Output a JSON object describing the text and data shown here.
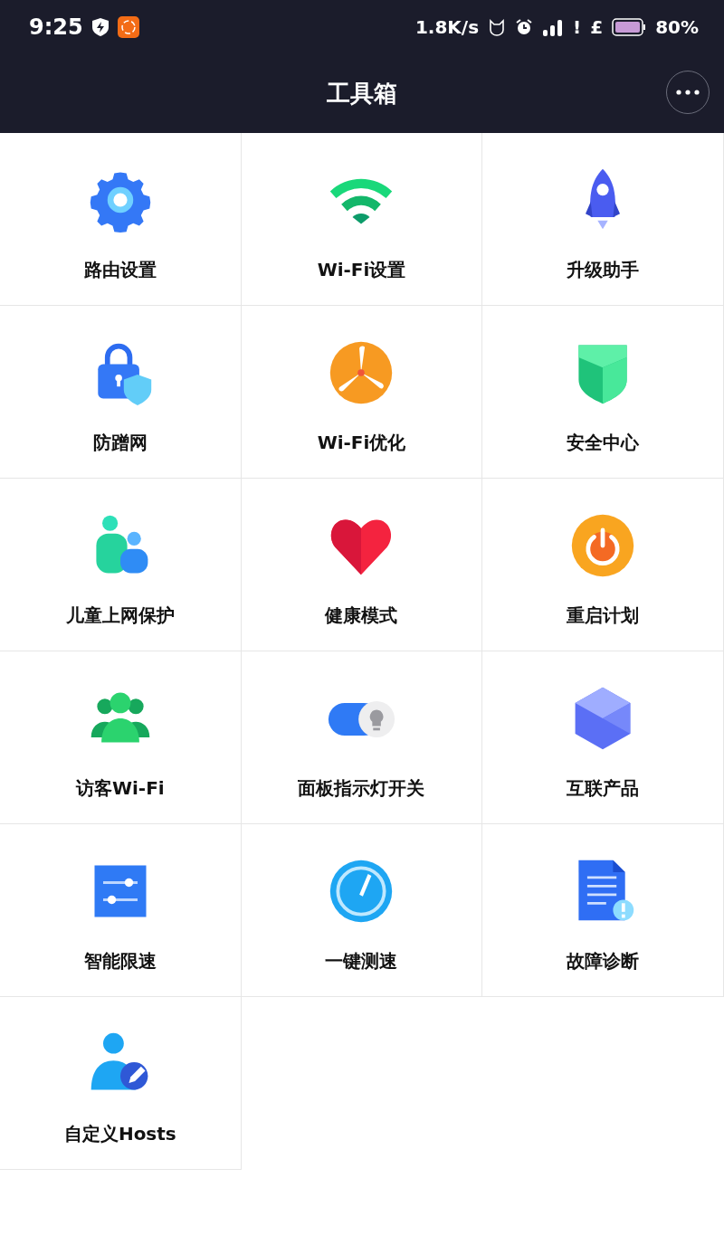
{
  "status_bar": {
    "time": "9:25",
    "speed": "1.8K/s",
    "alert": "!",
    "currency": "£",
    "battery": "80%"
  },
  "header": {
    "title": "工具箱"
  },
  "tools": [
    {
      "label": "路由设置",
      "kind": "gear"
    },
    {
      "label": "Wi-Fi设置",
      "kind": "wifi"
    },
    {
      "label": "升级助手",
      "kind": "rocket"
    },
    {
      "label": "防蹭网",
      "kind": "lock"
    },
    {
      "label": "Wi-Fi优化",
      "kind": "fan"
    },
    {
      "label": "安全中心",
      "kind": "shield"
    },
    {
      "label": "儿童上网保护",
      "kind": "family"
    },
    {
      "label": "健康模式",
      "kind": "heart"
    },
    {
      "label": "重启计划",
      "kind": "power"
    },
    {
      "label": "访客Wi-Fi",
      "kind": "people"
    },
    {
      "label": "面板指示灯开关",
      "kind": "toggle"
    },
    {
      "label": "互联产品",
      "kind": "cube"
    },
    {
      "label": "智能限速",
      "kind": "sliders"
    },
    {
      "label": "一键测速",
      "kind": "gauge"
    },
    {
      "label": "故障诊断",
      "kind": "document"
    },
    {
      "label": "自定义Hosts",
      "kind": "user-edit"
    }
  ]
}
